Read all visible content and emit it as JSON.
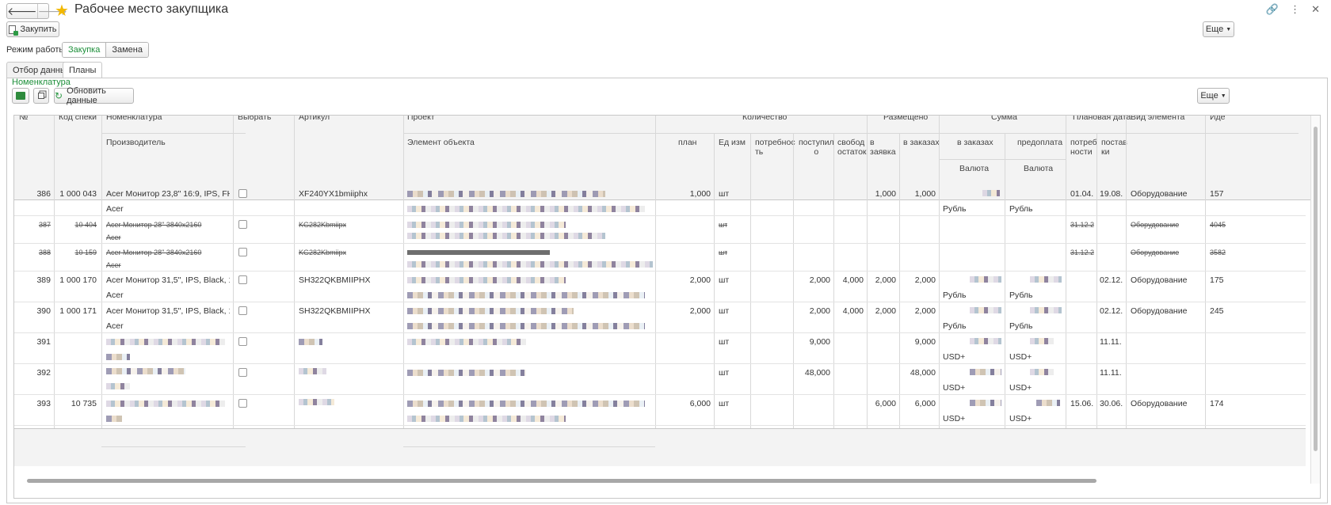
{
  "window": {
    "title": "Рабочее место закупщика",
    "back_glyph": "🡐",
    "forward_glyph": "🡒",
    "star_glyph": "★",
    "link_glyph": "🔗",
    "menu_glyph": "⋮",
    "close_glyph": "✕"
  },
  "toolbar": {
    "buy_label": "Закупить",
    "more_label": "Еще",
    "mode_label": "Режим работы:",
    "modes": [
      "Закупка",
      "Замена"
    ]
  },
  "tabs": [
    "Отбор данных",
    "Планы"
  ],
  "panel": {
    "nomenclature_link": "Номенклатура",
    "refresh_label": "Обновить данные",
    "more_label": "Еще"
  },
  "table": {
    "headers": {
      "no": "№",
      "code": "Код спеки",
      "nomenclature": "Номенклатура",
      "manufacturer": "Производитель",
      "select": "Выбрать",
      "article": "Артикул",
      "project": "Проект",
      "object_element": "Элемент объекта",
      "quantity": "Количество",
      "plan": "план",
      "unit": "Ед изм",
      "need": "потребнос\nть",
      "received": "поступил\nо",
      "free_stock": "свобод\nостаток",
      "placed": "Размещено",
      "in_request": "в\nзаявка",
      "in_orders": "в заказах",
      "sum": "Сумма",
      "sum_orders": "в заказах",
      "prepay": "предоплата",
      "currency1": "Валюта",
      "currency2": "Валюта",
      "plan_date": "Плановая дата",
      "need_date": "потреб\nности",
      "supply_date": "постав\nки",
      "element_type": "Вид элемента",
      "ident": "Иде"
    },
    "rows": [
      {
        "no": "386",
        "code": "1 000 043",
        "nom": "Acer Монитор 23,8\" 16:9, IPS, FHD, ...",
        "manuf": "Acer",
        "article": "XF240YX1bmiiphx",
        "plan": "1,000",
        "unit": "шт",
        "received": "",
        "free": "",
        "req": "1,000",
        "orders": "1,000",
        "cur1": "Рубль",
        "cur2": "Рубль",
        "d1": "01.04.",
        "d2": "19.08.",
        "type": "Оборудование",
        "id": "157",
        "struck": false
      },
      {
        "no": "387",
        "code": "10 404",
        "nom": "Acer Монитор 28\" 3840x2160",
        "manuf": "Acer",
        "article": "KG282Kbmiipx",
        "plan": "",
        "unit": "шт",
        "received": "",
        "free": "",
        "req": "",
        "orders": "",
        "cur1": "",
        "cur2": "",
        "d1": "31.12.2",
        "d2": "",
        "type": "Оборудование",
        "id": "4045",
        "struck": true
      },
      {
        "no": "388",
        "code": "10 159",
        "nom": "Acer Монитор 28\" 3840x2160",
        "manuf": "Acer",
        "article": "KG282Kbmiipx",
        "plan": "",
        "unit": "шт",
        "received": "",
        "free": "",
        "req": "",
        "orders": "",
        "cur1": "",
        "cur2": "",
        "d1": "31.12.2",
        "d2": "",
        "type": "Оборудование",
        "id": "3582",
        "struck": true
      },
      {
        "no": "389",
        "code": "1 000 170",
        "nom": "Acer Монитор 31,5\", IPS, Black, 16:...",
        "manuf": "Acer",
        "article": "SH322QKBMIIPHX",
        "plan": "2,000",
        "unit": "шт",
        "received": "2,000",
        "free": "4,000",
        "req": "2,000",
        "orders": "2,000",
        "cur1": "Рубль",
        "cur2": "Рубль",
        "d1": "",
        "d2": "02.12.",
        "type": "Оборудование",
        "id": "175",
        "struck": false
      },
      {
        "no": "390",
        "code": "1 000 171",
        "nom": "Acer Монитор 31,5\", IPS, Black, 16:...",
        "manuf": "Acer",
        "article": "SH322QKBMIIPHX",
        "plan": "2,000",
        "unit": "шт",
        "received": "2,000",
        "free": "4,000",
        "req": "2,000",
        "orders": "2,000",
        "cur1": "Рубль",
        "cur2": "Рубль",
        "d1": "",
        "d2": "02.12.",
        "type": "Оборудование",
        "id": "245",
        "struck": false
      },
      {
        "no": "391",
        "code": "",
        "nom": "",
        "manuf": "",
        "article": "",
        "plan": "",
        "unit": "шт",
        "received": "9,000",
        "free": "",
        "req": "",
        "orders": "9,000",
        "cur1": "USD+",
        "cur2": "USD+",
        "d1": "",
        "d2": "11.11.",
        "type": "",
        "id": "",
        "struck": false
      },
      {
        "no": "392",
        "code": "",
        "nom": "",
        "manuf": "",
        "article": "",
        "plan": "",
        "unit": "шт",
        "received": "48,000",
        "free": "",
        "req": "",
        "orders": "48,000",
        "cur1": "USD+",
        "cur2": "USD+",
        "d1": "",
        "d2": "11.11.",
        "type": "",
        "id": "",
        "struck": false
      },
      {
        "no": "393",
        "code": "10 735",
        "nom": "",
        "manuf": "",
        "article": "",
        "plan": "6,000",
        "unit": "шт",
        "received": "",
        "free": "",
        "req": "6,000",
        "orders": "6,000",
        "cur1": "USD+",
        "cur2": "USD+",
        "d1": "15.06.",
        "d2": "30.06.",
        "type": "Оборудование",
        "id": "174",
        "struck": false
      }
    ]
  }
}
